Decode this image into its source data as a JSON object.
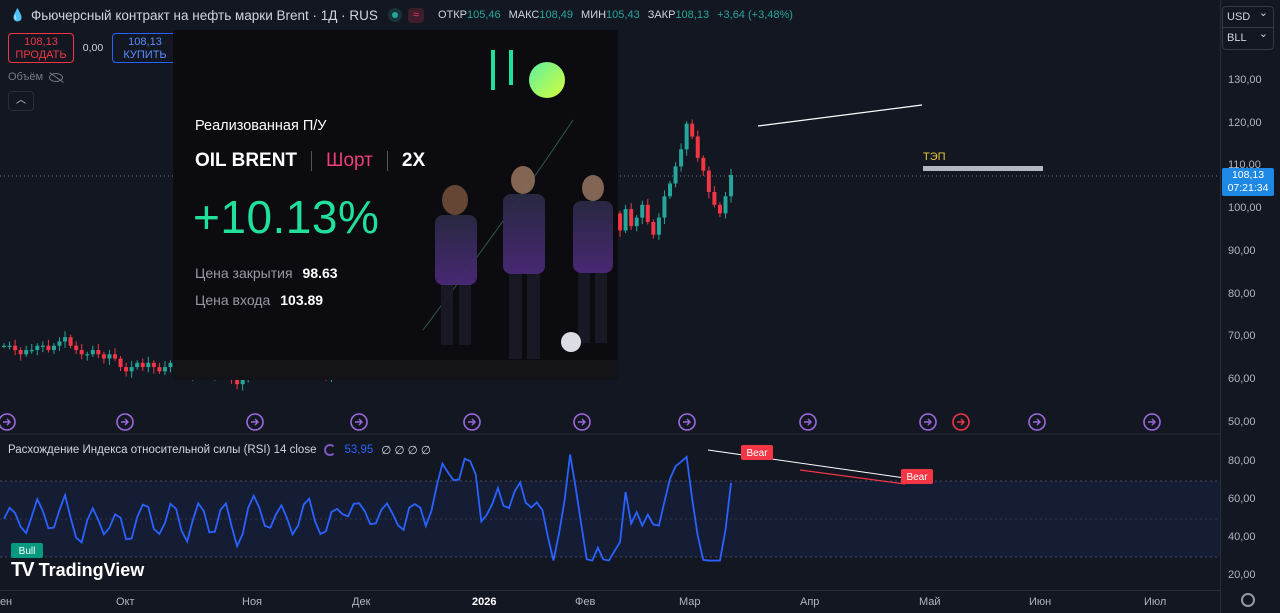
{
  "header": {
    "symbol": "Фьючерсный контракт на нефть марки Brent · 1Д · RUS",
    "badge": "≈",
    "ohlc": [
      {
        "k": "ОТКР",
        "v": "105,46"
      },
      {
        "k": "МАКС",
        "v": "108,49"
      },
      {
        "k": "МИН",
        "v": "105,43"
      },
      {
        "k": "ЗАКР",
        "v": "108,13"
      },
      {
        "k": "",
        "v": "+3,64 (+3,48%)"
      }
    ]
  },
  "trade": {
    "sell_price": "108,13",
    "sell_label": "ПРОДАТЬ",
    "spread": "0,00",
    "buy_price": "108,13",
    "buy_label": "КУПИТЬ"
  },
  "volume_label": "Объём",
  "currency": {
    "value": "USD",
    "unit": "BLL"
  },
  "promo": {
    "title": "Реализованная П/У",
    "pair": "OIL BRENT",
    "side": "Шорт",
    "leverage": "2X",
    "pnl": "+10.13%",
    "close_label": "Цена закрытия",
    "close_value": "98.63",
    "entry_label": "Цена входа",
    "entry_value": "103.89"
  },
  "price_axis": [
    "130,00",
    "120,00",
    "110,00",
    "100,00",
    "90,00",
    "80,00",
    "70,00",
    "60,00",
    "50,00"
  ],
  "last_price": {
    "value": "108,13",
    "countdown": "07:21:34"
  },
  "rsi": {
    "legend": "Расхождение Индекса относительной силы (RSI) 14 close",
    "value": "53,95",
    "extra": "∅ ∅ ∅ ∅",
    "axis": [
      "80,00",
      "60,00",
      "40,00",
      "20,00"
    ],
    "bull_label": "Bull",
    "bear_label": "Bear"
  },
  "chart_label": "ТЭП",
  "logo": "TradingView",
  "time_axis": [
    {
      "label": "Сен"
    },
    {
      "label": "Окт"
    },
    {
      "label": "Ноя"
    },
    {
      "label": "Дек"
    },
    {
      "label": "2026",
      "bold": true
    },
    {
      "label": "Фев"
    },
    {
      "label": "Мар"
    },
    {
      "label": "Апр"
    },
    {
      "label": "Май"
    },
    {
      "label": "Июн"
    },
    {
      "label": "Июл"
    }
  ],
  "colors": {
    "up": "#26a69a",
    "down": "#f23645",
    "rsi": "#2962ff",
    "bg": "#131722"
  },
  "chart_data": {
    "type": "candlestick",
    "ylim": [
      50,
      130
    ],
    "closes": [
      68,
      68,
      67,
      66,
      67,
      67,
      68,
      68,
      67,
      68,
      69,
      70,
      68,
      67,
      66,
      66,
      67,
      66,
      65,
      66,
      65,
      63,
      62,
      63,
      64,
      63,
      64,
      63,
      62,
      63,
      64,
      63,
      62,
      61,
      62,
      63,
      62,
      61,
      62,
      63,
      62,
      60,
      59,
      60,
      61,
      62,
      63,
      62,
      61,
      62,
      63,
      62,
      61,
      62,
      63,
      64,
      63,
      62,
      61,
      62,
      63,
      64,
      65,
      66,
      65,
      66,
      67,
      66,
      67,
      68,
      67,
      68,
      67,
      68,
      69,
      70,
      69,
      72,
      76,
      80,
      84,
      88,
      90,
      96,
      100,
      102,
      98,
      101,
      103,
      104,
      106,
      108,
      110,
      112,
      111,
      115,
      118,
      112,
      108,
      104,
      111,
      114,
      119,
      116,
      113,
      112,
      107,
      104,
      100,
      96,
      99,
      95,
      100,
      96,
      98,
      101,
      97,
      94,
      98,
      103,
      106,
      110,
      114,
      120,
      117,
      112,
      109,
      104,
      101,
      99,
      103,
      108
    ]
  }
}
